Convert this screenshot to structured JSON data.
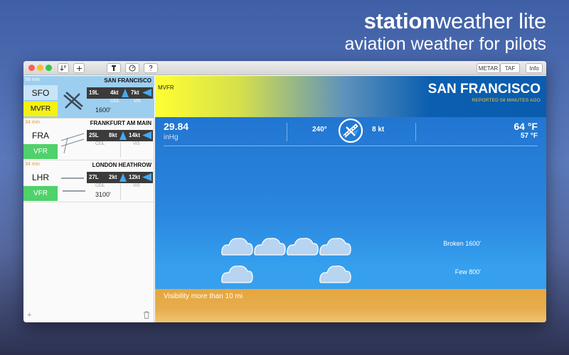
{
  "promo": {
    "title_bold": "station",
    "title_rest": "weather lite",
    "subtitle": "aviation weather for pilots"
  },
  "toolbar": {
    "metar_label": "METAR",
    "taf_label": "TAF",
    "info_label": "Info",
    "icons": [
      "sort-icon",
      "add-icon",
      "runway-icon",
      "compass-icon",
      "help-icon"
    ]
  },
  "stations": [
    {
      "age": "58 min",
      "name": "SAN FRANCISCO",
      "code": "SFO",
      "category": "MVFR",
      "runway": "19L",
      "headwind": "4kt",
      "crosswind": "7kt",
      "ceil_label": "CEIL",
      "vis_label": "VIS",
      "ceil_value": "1600'",
      "vis_value": "",
      "selected": true
    },
    {
      "age": "34 min",
      "name": "FRANKFURT AM MAIN",
      "code": "FRA",
      "category": "VFR",
      "runway": "25L",
      "headwind": "8kt",
      "crosswind": "14kt",
      "ceil_label": "CEIL",
      "vis_label": "VIS",
      "ceil_value": "",
      "vis_value": "",
      "selected": false
    },
    {
      "age": "34 min",
      "name": "LONDON HEATHROW",
      "code": "LHR",
      "category": "VFR",
      "runway": "27L",
      "headwind": "2kt",
      "crosswind": "12kt",
      "ceil_label": "CEIL",
      "vis_label": "VIS",
      "ceil_value": "3100'",
      "vis_value": "",
      "selected": false
    }
  ],
  "sidebar_footer": {
    "add_label": "+"
  },
  "detail": {
    "category": "MVFR",
    "city": "SAN FRANCISCO",
    "reported": "REPORTED 58 MINUTES AGO",
    "pressure": "29.84",
    "pressure_unit": "inHg",
    "wind_dir": "240°",
    "wind_speed": "8 kt",
    "temperature": "64 °F",
    "dewpoint": "57 °F",
    "layers": [
      "Broken 1600'",
      "Few 800'"
    ],
    "visibility": "Visibility more than 10 mi"
  },
  "colors": {
    "mvfr": "#f5f114",
    "vfr": "#4fd16b",
    "sky": "#2a86de",
    "ground": "#e7a63c",
    "accent_time": "#f3c830"
  }
}
